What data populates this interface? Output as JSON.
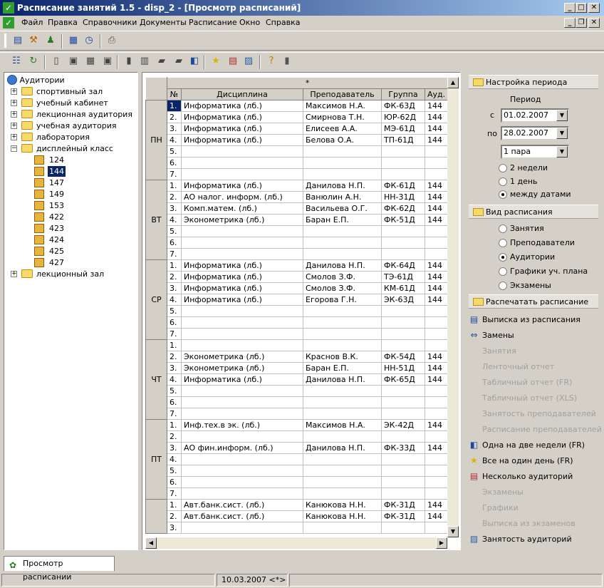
{
  "window": {
    "title": "Расписание занятий 1.5 - disp_2 - [Просмотр расписаний]",
    "minimize": "_",
    "maximize": "□",
    "close": "✕",
    "child_restore": "❐"
  },
  "menu": [
    "Файл",
    "Правка",
    "Справочники",
    "Документы",
    "Расписание",
    "Окно",
    "Справка"
  ],
  "tree": {
    "root": "Аудитории",
    "groups_before": [
      "спортивный зал",
      "учебный кабинет",
      "лекционная аудитория",
      "учебная аудитория",
      "лаборатория"
    ],
    "expanded_group": "дисплейный класс",
    "rooms": [
      "124",
      "144",
      "147",
      "149",
      "153",
      "422",
      "423",
      "424",
      "425",
      "427"
    ],
    "selected_room": "144",
    "groups_after": [
      "лекционный зал"
    ]
  },
  "grid": {
    "star": "*",
    "columns": [
      "№",
      "Дисциплина",
      "Преподаватель",
      "Группа",
      "Ауд."
    ],
    "selected_cell": "1.",
    "days": [
      {
        "day": "ПН",
        "rows": [
          {
            "n": "1.",
            "d": "Информатика (лб.)",
            "t": "Максимов Н.А.",
            "g": "ФК-63Д",
            "a": "144"
          },
          {
            "n": "2.",
            "d": "Информатика (лб.)",
            "t": "Смирнова Т.Н.",
            "g": "ЮР-62Д",
            "a": "144"
          },
          {
            "n": "3.",
            "d": "Информатика (лб.)",
            "t": "Елисеев А.А.",
            "g": "МЭ-61Д",
            "a": "144"
          },
          {
            "n": "4.",
            "d": "Информатика (лб.)",
            "t": "Белова О.А.",
            "g": "ТП-61Д",
            "a": "144"
          },
          {
            "n": "5.",
            "d": "",
            "t": "",
            "g": "",
            "a": ""
          },
          {
            "n": "6.",
            "d": "",
            "t": "",
            "g": "",
            "a": ""
          },
          {
            "n": "7.",
            "d": "",
            "t": "",
            "g": "",
            "a": ""
          }
        ]
      },
      {
        "day": "ВТ",
        "rows": [
          {
            "n": "1.",
            "d": "Информатика (лб.)",
            "t": "Данилова Н.П.",
            "g": "ФК-61Д",
            "a": "144"
          },
          {
            "n": "2.",
            "d": "АО налог. информ. (лб.)",
            "t": "Ванюлин А.Н.",
            "g": "НН-31Д",
            "a": "144"
          },
          {
            "n": "3.",
            "d": "Комп.матем. (лб.)",
            "t": "Васильева О.Г.",
            "g": "ФК-62Д",
            "a": "144"
          },
          {
            "n": "4.",
            "d": "Эконометрика (лб.)",
            "t": "Баран Е.П.",
            "g": "ФК-51Д",
            "a": "144"
          },
          {
            "n": "5.",
            "d": "",
            "t": "",
            "g": "",
            "a": ""
          },
          {
            "n": "6.",
            "d": "",
            "t": "",
            "g": "",
            "a": ""
          },
          {
            "n": "7.",
            "d": "",
            "t": "",
            "g": "",
            "a": ""
          }
        ]
      },
      {
        "day": "СР",
        "rows": [
          {
            "n": "1.",
            "d": "Информатика (лб.)",
            "t": "Данилова Н.П.",
            "g": "ФК-64Д",
            "a": "144"
          },
          {
            "n": "2.",
            "d": "Информатика (лб.)",
            "t": "Смолов З.Ф.",
            "g": "ТЭ-61Д",
            "a": "144"
          },
          {
            "n": "3.",
            "d": "Информатика (лб.)",
            "t": "Смолов З.Ф.",
            "g": "КМ-61Д",
            "a": "144"
          },
          {
            "n": "4.",
            "d": "Информатика (лб.)",
            "t": "Егорова Г.Н.",
            "g": "ЭК-63Д",
            "a": "144"
          },
          {
            "n": "5.",
            "d": "",
            "t": "",
            "g": "",
            "a": ""
          },
          {
            "n": "6.",
            "d": "",
            "t": "",
            "g": "",
            "a": ""
          },
          {
            "n": "7.",
            "d": "",
            "t": "",
            "g": "",
            "a": ""
          }
        ]
      },
      {
        "day": "ЧТ",
        "rows": [
          {
            "n": "1.",
            "d": "",
            "t": "",
            "g": "",
            "a": ""
          },
          {
            "n": "2.",
            "d": "Эконометрика (лб.)",
            "t": "Краснов В.К.",
            "g": "ФК-54Д",
            "a": "144"
          },
          {
            "n": "3.",
            "d": "Эконометрика (лб.)",
            "t": "Баран Е.П.",
            "g": "НН-51Д",
            "a": "144"
          },
          {
            "n": "4.",
            "d": "Информатика (лб.)",
            "t": "Данилова Н.П.",
            "g": "ФК-65Д",
            "a": "144"
          },
          {
            "n": "5.",
            "d": "",
            "t": "",
            "g": "",
            "a": ""
          },
          {
            "n": "6.",
            "d": "",
            "t": "",
            "g": "",
            "a": ""
          },
          {
            "n": "7.",
            "d": "",
            "t": "",
            "g": "",
            "a": ""
          }
        ]
      },
      {
        "day": "ПТ",
        "rows": [
          {
            "n": "1.",
            "d": "Инф.тех.в эк. (лб.)",
            "t": "Максимов Н.А.",
            "g": "ЭК-42Д",
            "a": "144"
          },
          {
            "n": "2.",
            "d": "",
            "t": "",
            "g": "",
            "a": ""
          },
          {
            "n": "3.",
            "d": "АО фин.информ. (лб.)",
            "t": "Данилова Н.П.",
            "g": "ФК-33Д",
            "a": "144"
          },
          {
            "n": "4.",
            "d": "",
            "t": "",
            "g": "",
            "a": ""
          },
          {
            "n": "5.",
            "d": "",
            "t": "",
            "g": "",
            "a": ""
          },
          {
            "n": "6.",
            "d": "",
            "t": "",
            "g": "",
            "a": ""
          },
          {
            "n": "7.",
            "d": "",
            "t": "",
            "g": "",
            "a": ""
          }
        ]
      },
      {
        "day": "",
        "rows": [
          {
            "n": "1.",
            "d": "Авт.банк.сист. (лб.)",
            "t": "Канюкова  Н.Н.",
            "g": "ФК-31Д",
            "a": "144"
          },
          {
            "n": "2.",
            "d": "Авт.банк.сист. (лб.)",
            "t": "Канюкова  Н.Н.",
            "g": "ФК-31Д",
            "a": "144"
          },
          {
            "n": "3.",
            "d": "",
            "t": "",
            "g": "",
            "a": ""
          }
        ]
      }
    ]
  },
  "right": {
    "period_header": "Настройка периода",
    "period_label": "Период",
    "from_label": "с",
    "from_value": "01.02.2007",
    "to_label": "по",
    "to_value": "28.02.2007",
    "pair_value": "1 пара",
    "period_options": [
      {
        "label": "2 недели",
        "selected": false
      },
      {
        "label": "1 день",
        "selected": false
      },
      {
        "label": "между датами",
        "selected": true
      }
    ],
    "view_header": "Вид расписания",
    "view_options": [
      {
        "label": "Занятия",
        "selected": false
      },
      {
        "label": "Преподаватели",
        "selected": false
      },
      {
        "label": "Аудитории",
        "selected": true
      },
      {
        "label": "Графики уч. плана",
        "selected": false
      },
      {
        "label": "Экзамены",
        "selected": false
      }
    ],
    "print_header": "Распечатать расписание",
    "print_items": [
      {
        "label": "Выписка из расписания",
        "enabled": true,
        "icon": "document-icon"
      },
      {
        "label": "Замены",
        "enabled": true,
        "icon": "swap-arrows-icon"
      },
      {
        "label": "Занятия",
        "enabled": false,
        "icon": ""
      },
      {
        "label": "Ленточный отчет",
        "enabled": false,
        "icon": ""
      },
      {
        "label": "Табличный отчет (FR)",
        "enabled": false,
        "icon": ""
      },
      {
        "label": "Табличный отчет (XLS)",
        "enabled": false,
        "icon": ""
      },
      {
        "label": "Занятость преподавателей",
        "enabled": false,
        "icon": ""
      },
      {
        "label": "Расписание преподавателей",
        "enabled": false,
        "icon": ""
      },
      {
        "label": "Одна на две недели (FR)",
        "enabled": true,
        "icon": "book-icon"
      },
      {
        "label": "Все на один день (FR)",
        "enabled": true,
        "icon": "star-icon"
      },
      {
        "label": "Несколько аудиторий",
        "enabled": true,
        "icon": "report-icon"
      },
      {
        "label": "Экзамены",
        "enabled": false,
        "icon": ""
      },
      {
        "label": "Графики",
        "enabled": false,
        "icon": ""
      },
      {
        "label": "Выписка из экзаменов",
        "enabled": false,
        "icon": ""
      },
      {
        "label": "Занятость аудиторий",
        "enabled": true,
        "icon": "image-icon"
      }
    ]
  },
  "taskbar": {
    "tab": "Просмотр расписаний"
  },
  "statusbar": {
    "date": "10.03.2007 <*>"
  }
}
